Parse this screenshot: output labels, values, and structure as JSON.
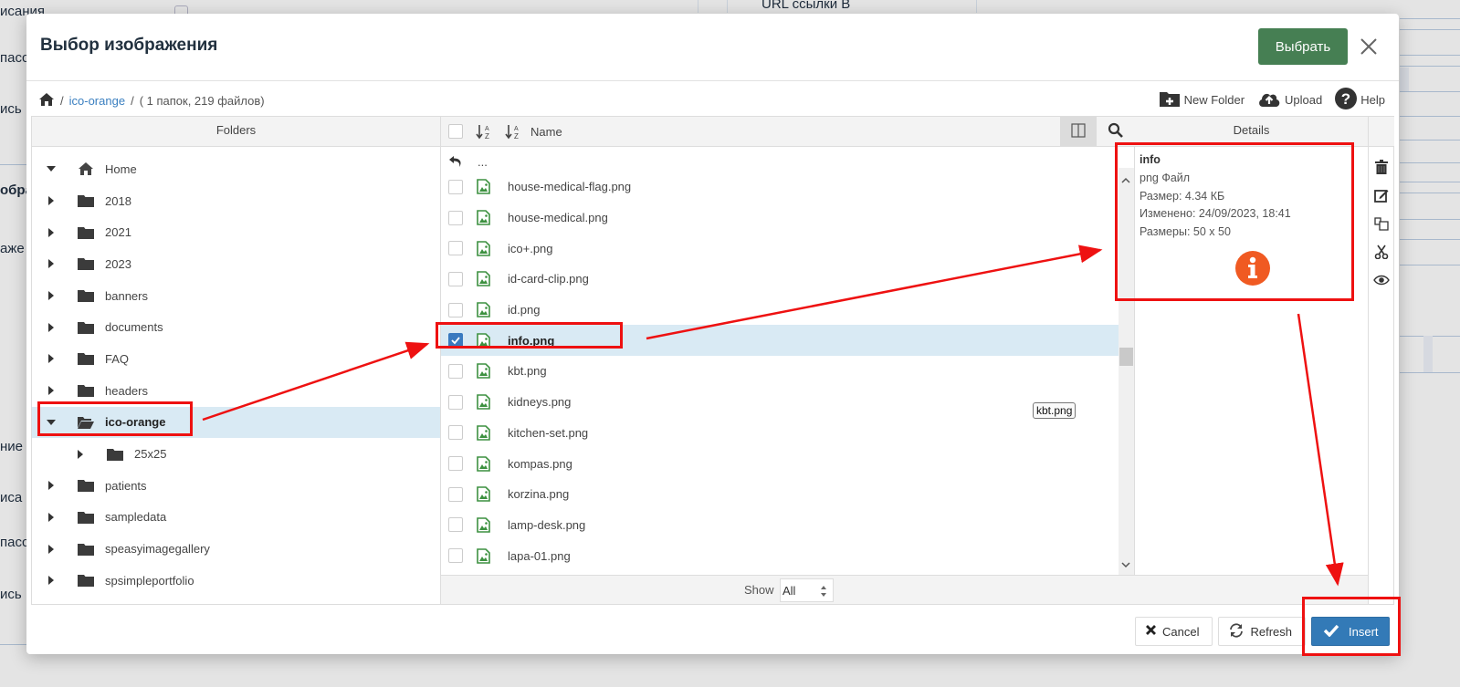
{
  "background": {
    "left_labels": [
      "исания",
      "пасс",
      "ись",
      "ображ",
      "аже",
      "ние",
      "иса",
      "пасс",
      "ись"
    ],
    "top_label": "URL ссылки В"
  },
  "modal": {
    "title": "Выбор изображения",
    "select_button": "Выбрать",
    "close_icon": "close-icon"
  },
  "breadcrumb": {
    "home_icon": "home-icon",
    "separator": "/",
    "current_folder": "ico-orange",
    "summary": "( 1 папок, 219 файлов)"
  },
  "toolbar": {
    "new_folder": "New Folder",
    "upload": "Upload",
    "help": "Help"
  },
  "folders": {
    "header": "Folders",
    "items": [
      {
        "label": "Home",
        "icon": "home-icon",
        "expanded": true,
        "level": 0
      },
      {
        "label": "2018",
        "icon": "folder-icon",
        "expanded": false,
        "level": 1
      },
      {
        "label": "2021",
        "icon": "folder-icon",
        "expanded": false,
        "level": 1
      },
      {
        "label": "2023",
        "icon": "folder-icon",
        "expanded": false,
        "level": 1
      },
      {
        "label": "banners",
        "icon": "folder-icon",
        "expanded": false,
        "level": 1
      },
      {
        "label": "documents",
        "icon": "folder-icon",
        "expanded": false,
        "level": 1
      },
      {
        "label": "FAQ",
        "icon": "folder-icon",
        "expanded": false,
        "level": 1
      },
      {
        "label": "headers",
        "icon": "folder-icon",
        "expanded": false,
        "level": 1
      },
      {
        "label": "ico-orange",
        "icon": "folder-open-icon",
        "expanded": true,
        "level": 1,
        "selected": true
      },
      {
        "label": "25x25",
        "icon": "folder-icon",
        "expanded": false,
        "level": 2
      },
      {
        "label": "patients",
        "icon": "folder-icon",
        "expanded": false,
        "level": 1
      },
      {
        "label": "sampledata",
        "icon": "folder-icon",
        "expanded": false,
        "level": 1
      },
      {
        "label": "speasyimagegallery",
        "icon": "folder-icon",
        "expanded": false,
        "level": 1
      },
      {
        "label": "spsimpleportfolio",
        "icon": "folder-icon",
        "expanded": false,
        "level": 1
      }
    ]
  },
  "files": {
    "header_name": "Name",
    "up_label": "...",
    "items": [
      {
        "name": "house-medical-flag.png",
        "checked": false
      },
      {
        "name": "house-medical.png",
        "checked": false
      },
      {
        "name": "ico+.png",
        "checked": false
      },
      {
        "name": "id-card-clip.png",
        "checked": false
      },
      {
        "name": "id.png",
        "checked": false
      },
      {
        "name": "info.png",
        "checked": true,
        "selected": true
      },
      {
        "name": "kbt.png",
        "checked": false
      },
      {
        "name": "kidneys.png",
        "checked": false
      },
      {
        "name": "kitchen-set.png",
        "checked": false
      },
      {
        "name": "kompas.png",
        "checked": false
      },
      {
        "name": "korzina.png",
        "checked": false
      },
      {
        "name": "lamp-desk.png",
        "checked": false
      },
      {
        "name": "lapa-01.png",
        "checked": false
      }
    ],
    "tooltip": "kbt.png",
    "show_label": "Show",
    "show_value": "All"
  },
  "details": {
    "header": "Details",
    "name": "info",
    "type": "png Файл",
    "size": "Размер: 4.34 КБ",
    "modified": "Изменено: 24/09/2023, 18:41",
    "dimensions": "Размеры: 50 x 50",
    "preview_icon": "info-icon",
    "preview_color": "#f05a22"
  },
  "actions": [
    "trash-icon",
    "edit-icon",
    "copy-icon",
    "cut-icon",
    "preview-eye-icon"
  ],
  "footer": {
    "cancel": "Cancel",
    "refresh": "Refresh",
    "insert": "Insert"
  },
  "colors": {
    "select_button": "#467f53",
    "insert_button": "#337ab7",
    "selection_bg": "#d9eaf4",
    "annotation": "#ee1111",
    "file_icon": "#3d9140"
  }
}
